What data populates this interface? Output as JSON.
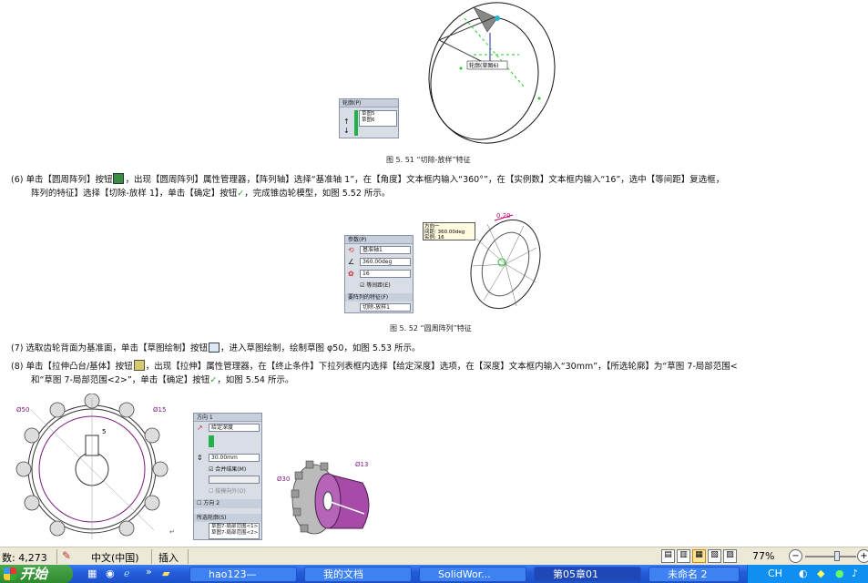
{
  "document": {
    "fig51_caption": "图 5. 51  “切除-放样”特征",
    "fig51_panel": {
      "title": "轮廓(P)",
      "items": [
        "草图5",
        "草图6"
      ]
    },
    "fig51_label": "轮廓(草图6)",
    "para6_line1": "(6)  单击【圆周阵列】按钮",
    "para6_line1b": "，出现【圆周阵列】属性管理器，【阵列轴】选择“基准轴 1”，在【角度】文本框内输入“360°”，在【实例数】文本框内输入“16”，选中【等间距】复选框，",
    "para6_line2": "阵列的特征】选择【切除-放样 1】，单击【确定】按钮",
    "para6_line2b": "，完成锥齿轮模型，如图 5.52 所示。",
    "fig52_caption": "图 5. 52  “圆周阵列”特征",
    "fig52_panel": {
      "title": "参数(P)",
      "axis": "基准轴1",
      "angle": "360.00deg",
      "count": "16",
      "equal": "等间距(E)",
      "feat_title": "要阵列的特征(F)",
      "feat_item": "切除-放样1"
    },
    "fig52_tooltip": {
      "title": "方向一",
      "row1_label": "间距:",
      "row1_value": "360.00deg",
      "row2_label": "实例:",
      "row2_value": "16"
    },
    "fig52_dim": "0.20",
    "para7": "(7)  选取齿轮背面为基准面，单击【草图绘制】按钮",
    "para7b": "，进入草图绘制，绘制草图 φ50，如图 5.53 所示。",
    "para8_line1": "(8)  单击【拉伸凸台/基体】按钮",
    "para8_line1b": "，出现【拉伸】属性管理器，在【终止条件】下拉列表框内选择【给定深度】选项，在【深度】文本框内输入“30mm”，【所选轮廓】为“草图 7-局部范围<",
    "para8_line2": "和“草图 7-局部范围<2>”，单击【确定】按钮",
    "para8_line2b": "，如图 5.54 所示。",
    "fig53_dims": {
      "d1": "Ø50",
      "d2": "Ø15",
      "d3": "5"
    },
    "fig54_panel": {
      "dir1": "方向 1",
      "type": "给定深度",
      "depth": "30.00mm",
      "merge": "合并结果(M)",
      "draft": "拔模向外(O)",
      "dir2": "方向 2",
      "contours": "所选轮廓(S)",
      "contour1": "草图7-局部范围<1>",
      "contour2": "草图7-局部范围<2>"
    },
    "fig54_dims": {
      "d1": "Ø30",
      "d2": "Ø13"
    }
  },
  "statusbar": {
    "words": "数: 4,273",
    "language": "中文(中国)",
    "mode": "插入",
    "zoom": "77%"
  },
  "taskbar": {
    "start": "开始",
    "tasks": [
      "hao123—",
      "我的文档",
      "SolidWor...",
      "第05章01",
      "未命名 2"
    ],
    "tray_text": "CH"
  }
}
